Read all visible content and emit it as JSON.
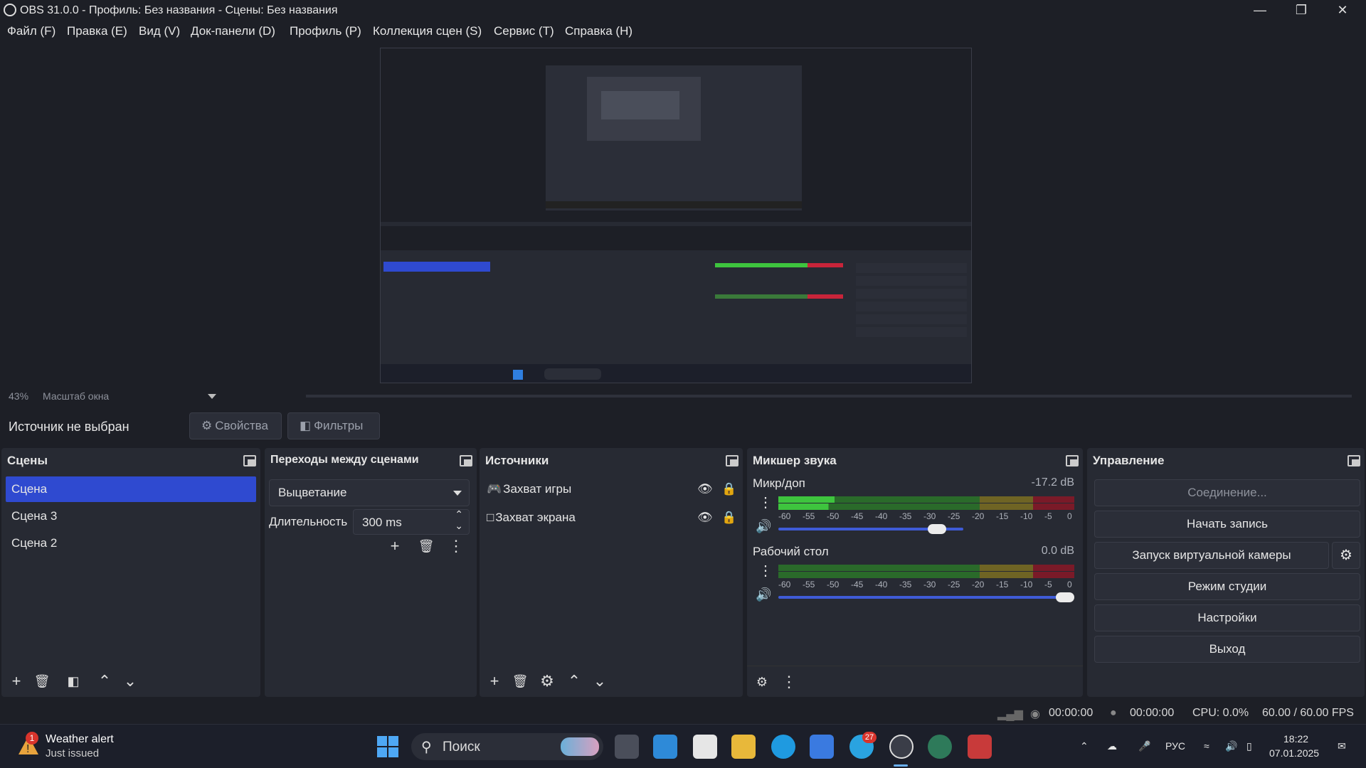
{
  "window": {
    "title": "OBS 31.0.0 - Профиль: Без названия - Сцены: Без названия"
  },
  "menu": [
    "Файл (F)",
    "Правка (E)",
    "Вид (V)",
    "Док-панели (D)",
    "Профиль (P)",
    "Коллекция сцен (S)",
    "Сервис (T)",
    "Справка (H)"
  ],
  "preview": {
    "zoom_percent": "43%",
    "zoom_label": "Масштаб окна"
  },
  "source_bar": {
    "no_source": "Источник не выбран",
    "properties": "Свойства",
    "filters": "Фильтры"
  },
  "scenes": {
    "title": "Сцены",
    "items": [
      "Сцена",
      "Сцена 3",
      "Сцена 2"
    ],
    "selected": "Сцена"
  },
  "transitions": {
    "title": "Переходы между сценами",
    "selected": "Выцветание",
    "duration_label": "Длительность",
    "duration_value": "300 ms"
  },
  "sources": {
    "title": "Источники",
    "items": [
      {
        "name": "Захват игры",
        "icon": "gamepad-icon"
      },
      {
        "name": "Захват экрана",
        "icon": "monitor-icon"
      }
    ]
  },
  "mixer": {
    "title": "Микшер звука",
    "channels": [
      {
        "name": "Микр/доп",
        "db": "-17.2 dB",
        "level": 0.18,
        "volume": 0.52
      },
      {
        "name": "Рабочий стол",
        "db": "0.0 dB",
        "level": 0.0,
        "volume": 1.0
      }
    ],
    "scale": [
      "-60",
      "-55",
      "-50",
      "-45",
      "-40",
      "-35",
      "-30",
      "-25",
      "-20",
      "-15",
      "-10",
      "-5",
      "0"
    ]
  },
  "controls": {
    "title": "Управление",
    "connect": "Соединение...",
    "record": "Начать запись",
    "virtual_cam": "Запуск виртуальной камеры",
    "studio_mode": "Режим студии",
    "settings": "Настройки",
    "exit": "Выход"
  },
  "status": {
    "stream_time": "00:00:00",
    "record_time": "00:00:00",
    "cpu": "CPU: 0.0%",
    "fps": "60.00 / 60.00 FPS"
  },
  "taskbar": {
    "weather_title": "Weather alert",
    "weather_sub": "Just issued",
    "weather_badge": "1",
    "search_placeholder": "Поиск",
    "telegram_badge": "27",
    "lang": "РУС",
    "time": "18:22",
    "date": "07.01.2025"
  },
  "colors": {
    "accent": "#2f4ad0",
    "meter_green": "#3ec43e",
    "meter_yellow": "#b5a026",
    "meter_red": "#c8243a"
  }
}
